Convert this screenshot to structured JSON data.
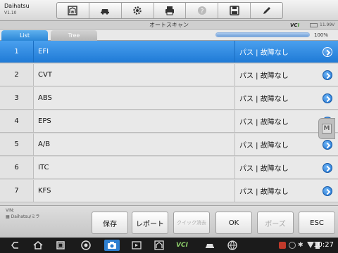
{
  "app": {
    "name": "Daihatsu",
    "version": "V1.10"
  },
  "toolbar": {
    "buttons": [
      {
        "icon": "home-icon"
      },
      {
        "icon": "car-icon"
      },
      {
        "icon": "gear-icon"
      },
      {
        "icon": "printer-icon"
      },
      {
        "icon": "help-icon"
      },
      {
        "icon": "save-icon"
      },
      {
        "icon": "pen-icon"
      }
    ]
  },
  "header": {
    "title": "オートスキャン",
    "vci_text": "VC",
    "vci_accent": "I",
    "voltage": "11.99V"
  },
  "tabs": [
    {
      "label": "List",
      "active": true
    },
    {
      "label": "Tree",
      "active": false
    }
  ],
  "scan": {
    "progress_percent": 100,
    "progress_text": "100%"
  },
  "list": [
    {
      "num": "1",
      "name": "EFI",
      "status": "パス | 故障なし",
      "selected": true
    },
    {
      "num": "2",
      "name": "CVT",
      "status": "パス | 故障なし",
      "selected": false
    },
    {
      "num": "3",
      "name": "ABS",
      "status": "パス | 故障なし",
      "selected": false
    },
    {
      "num": "4",
      "name": "EPS",
      "status": "パス | 故障なし",
      "selected": false
    },
    {
      "num": "5",
      "name": "A/B",
      "status": "パス | 故障なし",
      "selected": false
    },
    {
      "num": "6",
      "name": "ITC",
      "status": "パス | 故障なし",
      "selected": false
    },
    {
      "num": "7",
      "name": "KFS",
      "status": "パス | 故障なし",
      "selected": false
    }
  ],
  "footer": {
    "vin_label": "VIN:",
    "vehicle": "Daihatsu/ミラ",
    "buttons": {
      "save": "保存",
      "report": "レポート",
      "quick_erase": "クイック消去",
      "ok": "OK",
      "pause": "ポーズ",
      "esc": "ESC"
    }
  },
  "system_bar": {
    "time": "10:27",
    "vci_text": "VC",
    "vci_accent": "I"
  },
  "colors": {
    "accent": "#2b86d6",
    "vci_green": "#3a8f2a"
  }
}
